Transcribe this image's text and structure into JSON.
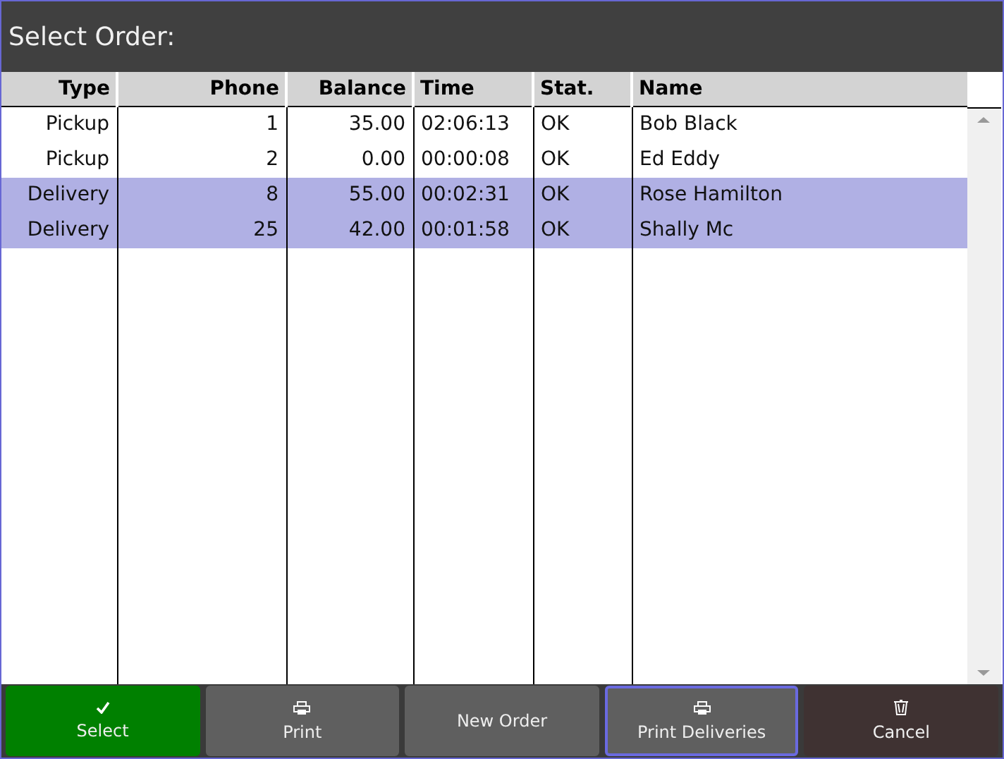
{
  "window": {
    "title": "Select Order:"
  },
  "table": {
    "columns": [
      "Type",
      "Phone",
      "Balance",
      "Time",
      "Stat.",
      "Name"
    ],
    "rows": [
      {
        "selected": false,
        "cells": [
          "Pickup",
          "1",
          "35.00",
          "02:06:13",
          "OK",
          "Bob Black"
        ]
      },
      {
        "selected": false,
        "cells": [
          "Pickup",
          "2",
          "0.00",
          "00:00:08",
          "OK",
          "Ed Eddy"
        ]
      },
      {
        "selected": true,
        "cells": [
          "Delivery",
          "8",
          "55.00",
          "00:02:31",
          "OK",
          "Rose Hamilton"
        ]
      },
      {
        "selected": true,
        "cells": [
          "Delivery",
          "25",
          "42.00",
          "00:01:58",
          "OK",
          "Shally Mc"
        ]
      }
    ]
  },
  "buttons": [
    {
      "label": "Select",
      "kind": "confirm",
      "focused": false
    },
    {
      "label": "Print",
      "kind": "print",
      "focused": false
    },
    {
      "label": "New Order",
      "kind": "plain",
      "focused": false
    },
    {
      "label": "Print Deliveries",
      "kind": "print",
      "focused": true
    },
    {
      "label": "Cancel",
      "kind": "cancel",
      "focused": false
    }
  ]
}
